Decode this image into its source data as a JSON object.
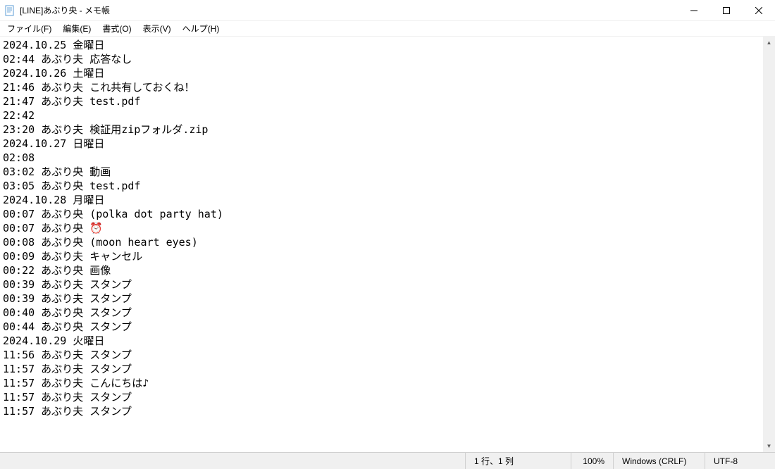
{
  "titlebar": {
    "title": "[LINE]あぶり央 - メモ帳"
  },
  "menubar": {
    "file": "ファイル(F)",
    "edit": "編集(E)",
    "format": "書式(O)",
    "view": "表示(V)",
    "help": "ヘルプ(H)"
  },
  "content": {
    "lines": [
      "2024.10.25 金曜日",
      "02:44 あぶり夫 応答なし",
      "2024.10.26 土曜日",
      "21:46 あぶり夫 これ共有しておくね！",
      "21:47 あぶり夫 test.pdf",
      "22:42",
      "23:20 あぶり夫 検証用zipフォルダ.zip",
      "2024.10.27 日曜日",
      "02:08",
      "03:02 あぶり央 動画",
      "03:05 あぶり央 test.pdf",
      "2024.10.28 月曜日",
      "00:07 あぶり央 (polka dot party hat)",
      "00:07 あぶり央 ⏰",
      "00:08 あぶり央 (moon heart eyes)",
      "00:09 あぶり夫 キャンセル",
      "00:22 あぶり央 画像",
      "00:39 あぶり夫 スタンプ",
      "00:39 あぶり夫 スタンプ",
      "00:40 あぶり央 スタンプ",
      "00:44 あぶり央 スタンプ",
      "2024.10.29 火曜日",
      "11:56 あぶり夫 スタンプ",
      "11:57 あぶり夫 スタンプ",
      "11:57 あぶり夫 こんにちは♪",
      "11:57 あぶり夫 スタンプ",
      "11:57 あぶり夫 スタンプ"
    ]
  },
  "statusbar": {
    "position": "1 行、1 列",
    "zoom": "100%",
    "eol": "Windows (CRLF)",
    "encoding": "UTF-8"
  }
}
